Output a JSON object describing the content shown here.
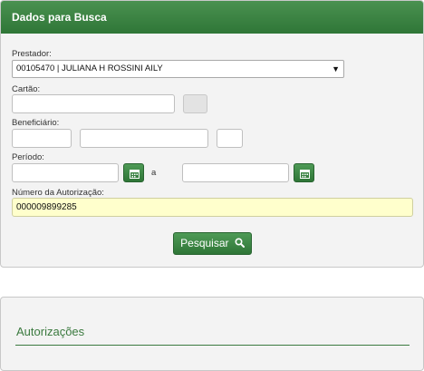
{
  "search_panel": {
    "title": "Dados para Busca",
    "prestador": {
      "label": "Prestador:",
      "selected": "00105470 | JULIANA H ROSSINI AILY"
    },
    "cartao": {
      "label": "Cartão:",
      "value": ""
    },
    "beneficiario": {
      "label": "Beneficiário:"
    },
    "periodo": {
      "label": "Período:",
      "separator": "a"
    },
    "numero_autorizacao": {
      "label": "Número da Autorização:",
      "value": "000009899285"
    },
    "search_button": {
      "label": "Pesquisar",
      "icon": "search-icon"
    }
  },
  "results_panel": {
    "title": "Autorizações"
  },
  "colors": {
    "header_green": "#3c8643",
    "button_green": "#3a8241",
    "highlight_field": "#ffffcc"
  }
}
